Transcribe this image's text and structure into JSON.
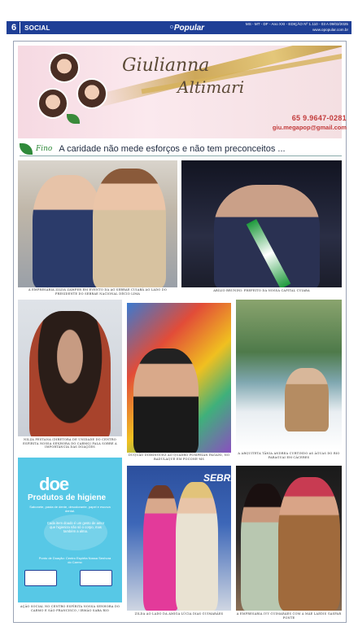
{
  "header": {
    "page_number": "6",
    "section": "SOCIAL",
    "logo_small": "O",
    "logo": "Popular",
    "edition_line1": "MS - MT - DF - Ano XXI - EDIÇÃO Nº 1.110 - 03 A 09/02/2025",
    "edition_line2": "www.opopular.com.br"
  },
  "banner": {
    "name_line1": "Giulianna",
    "name_line2": "Altimari",
    "phone": "65 9.9647-0281",
    "email": "giu.megapop@gmail.com"
  },
  "headline": {
    "tag": "Fino",
    "text": "A caridade não mede esforços e não tem preconceitos ..."
  },
  "captions": {
    "c1": "A empresária Zilda Zamper em evento da AG SEBRAE Cuiabá ao lado do presidente do Sebrae Nacional Décio Lima",
    "c2": "Abílio Brunini: Prefeito da nossa capital Cuiabá",
    "c3": "Nilza Pestana (diretora de Unidade do Centro Espírita Nossa Senhora do Carmo) fala sobre a importância das doações",
    "c4": "Duquão Dominguez ao quadro Pompeian Pagani, no Badulaque em Pocone-MS",
    "c5": "A arquiteta Tânia Andrea curtindo as águas do Rio Paraguai em Cáceres",
    "c6": "Ação Social no Centro Espírita Nossa Senhora do Carmo e São Francisco / Irmão Saba Rio",
    "c7": "Zilda ao lado da amiga Lúcia Dias Guimarães",
    "c8": "A empresária Ivy Guimarães com a mãe Laedis Gaspar Ponte"
  },
  "flyer": {
    "title": "doe",
    "subtitle": "Produtos de higiene",
    "items": "Sabonete, pasta de dente, desodorante, papel e escova dental.",
    "message": "Cada item doado é um gesto de amor que higieniza não só o corpo, mas também a alma.",
    "place": "Ponto de Doação: Centro Espírita Nossa Senhora do Carmo"
  },
  "sebrae_sign": "SEBRAE",
  "colors": {
    "header_blue": "#1f3f96",
    "accent_red": "#c23b3b",
    "gold": "#c9a14a"
  }
}
